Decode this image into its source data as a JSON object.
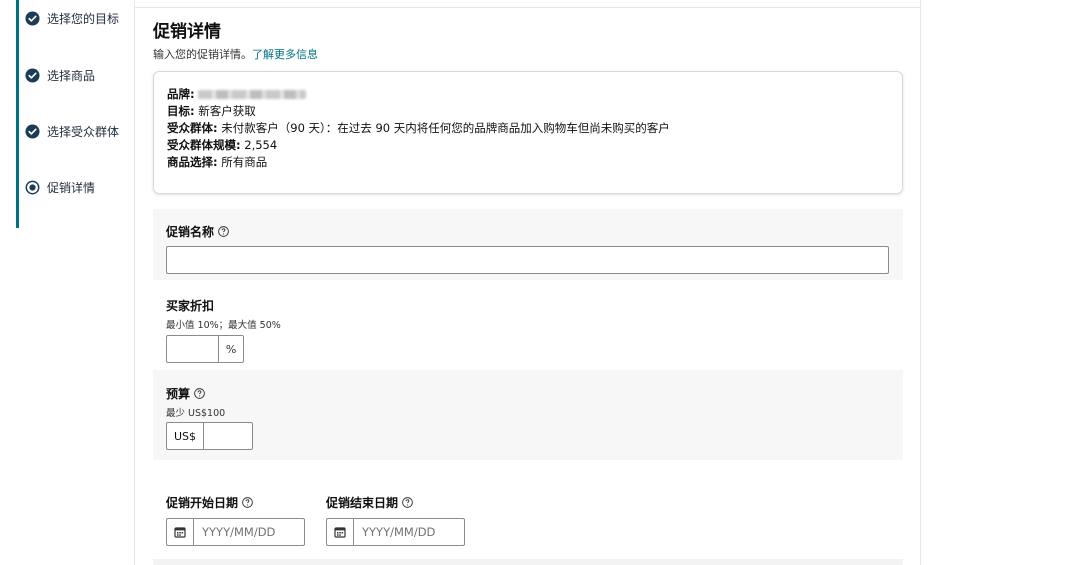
{
  "stepper": {
    "steps": [
      {
        "label": "选择您的目标",
        "state": "complete"
      },
      {
        "label": "选择商品",
        "state": "complete"
      },
      {
        "label": "选择受众群体",
        "state": "complete"
      },
      {
        "label": "促销详情",
        "state": "current"
      }
    ]
  },
  "header": {
    "title": "促销详情",
    "subtitle": "输入您的促销详情。",
    "learn_more": "了解更多信息"
  },
  "summary": {
    "brand_label": "品牌:",
    "goal_label": "目标:",
    "goal_value": "新客户获取",
    "audience_label": "受众群体:",
    "audience_value": "未付款客户（90 天）：在过去 90 天内将任何您的品牌商品加入购物车但尚未购买的客户",
    "audience_size_label": "受众群体规模:",
    "audience_size_value": "2,554",
    "product_label": "商品选择:",
    "product_value": "所有商品"
  },
  "fields": {
    "promo_name": {
      "label": "促销名称",
      "value": "",
      "icon": "help-icon"
    },
    "discount": {
      "label": "买家折扣",
      "hint": "最小值 10%；最大值 50%",
      "suffix": "%",
      "value": ""
    },
    "budget": {
      "label": "预算",
      "hint": "最少 US$100",
      "prefix": "US$",
      "value": "",
      "icon": "help-icon"
    },
    "start_date": {
      "label": "促销开始日期",
      "placeholder": "YYYY/MM/DD",
      "icon": "calendar-icon"
    },
    "end_date": {
      "label": "促销结束日期",
      "placeholder": "YYYY/MM/DD",
      "icon": "calendar-icon"
    }
  },
  "colors": {
    "accent": "#007185",
    "step_check": "#1b3b57",
    "section_bg": "#f7f7f7"
  }
}
